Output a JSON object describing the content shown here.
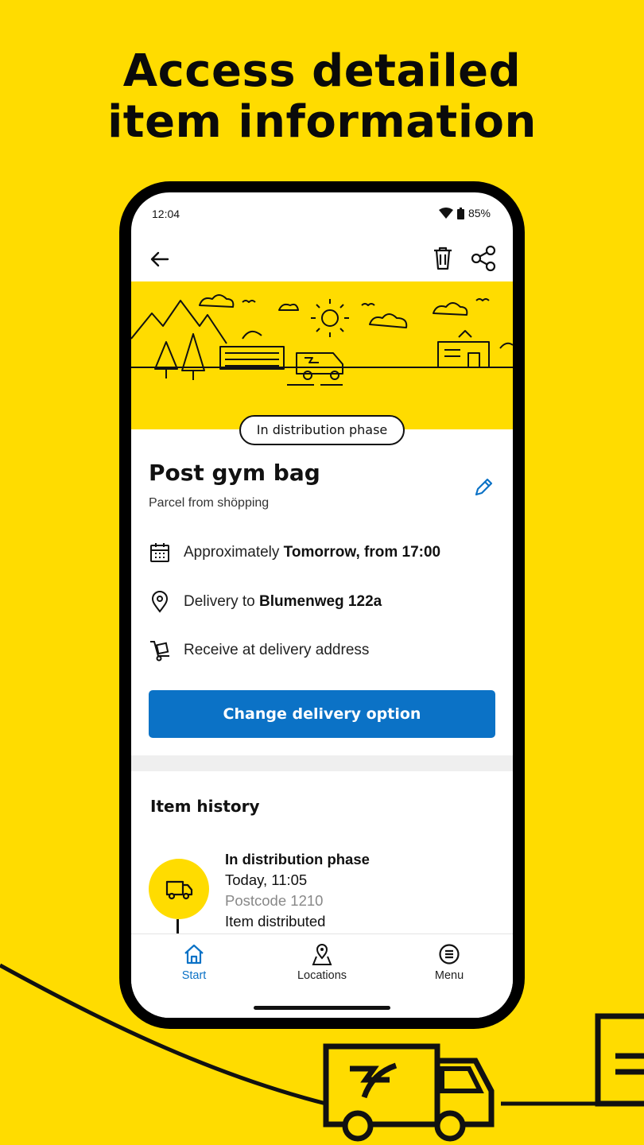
{
  "headline": {
    "line1": "Access detailed",
    "line2": "item information"
  },
  "status_bar": {
    "time": "12:04",
    "battery": "85%"
  },
  "badge": {
    "phase": "In distribution phase"
  },
  "item": {
    "title": "Post gym bag",
    "subtitle": "Parcel from shöpping",
    "eta_prefix": "Approximately ",
    "eta_value": "Tomorrow, from 17:00",
    "delivery_prefix": "Delivery to ",
    "delivery_address": "Blumenweg 122a",
    "receive_option": "Receive at delivery address"
  },
  "cta": {
    "label": "Change delivery option"
  },
  "history": {
    "title": "Item history",
    "entries": [
      {
        "status": "In distribution phase",
        "time": "Today, 11:05",
        "postcode": "Postcode 1210",
        "detail": "Item distributed"
      }
    ]
  },
  "bottom_nav": [
    {
      "label": "Start",
      "icon": "home-icon",
      "active": true
    },
    {
      "label": "Locations",
      "icon": "map-pin-icon",
      "active": false
    },
    {
      "label": "Menu",
      "icon": "menu-icon",
      "active": false
    }
  ],
  "colors": {
    "brand_yellow": "#FFDC00",
    "primary_blue": "#0B72C6"
  }
}
